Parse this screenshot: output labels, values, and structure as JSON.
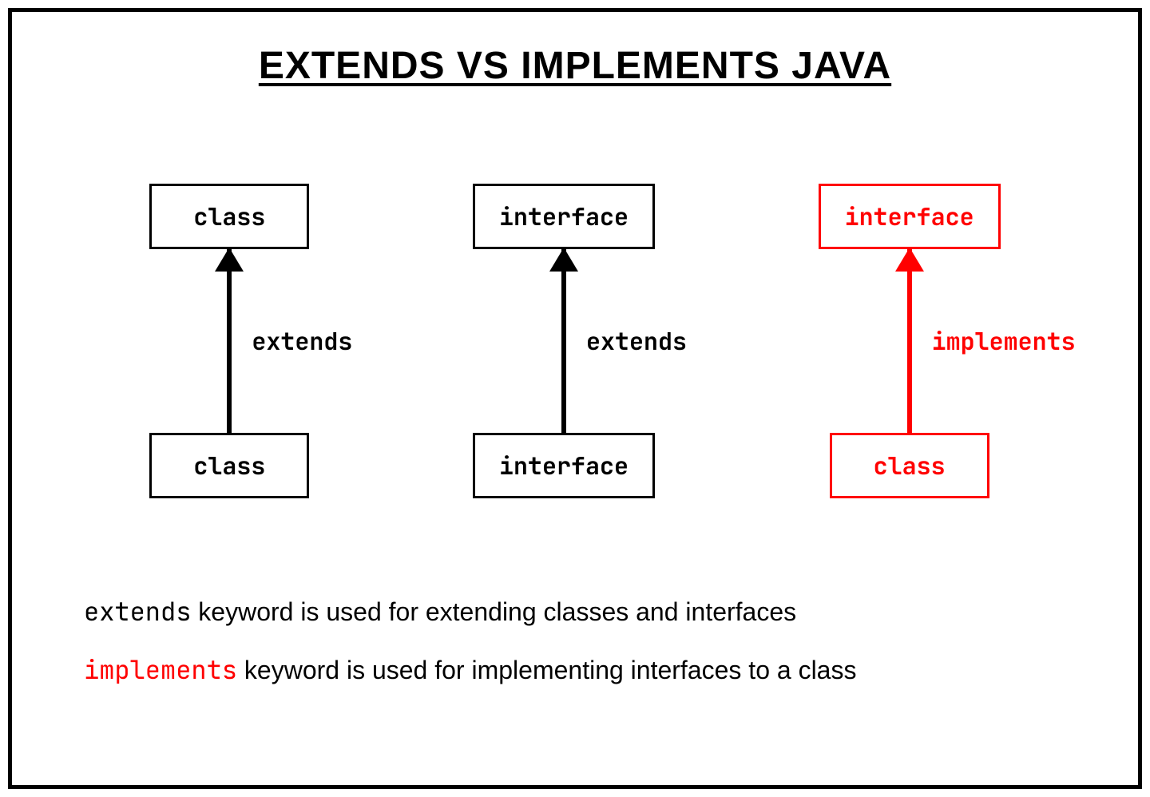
{
  "title": "EXTENDS VS IMPLEMENTS JAVA",
  "columns": [
    {
      "top": "class",
      "bottom": "class",
      "label": "extends",
      "variant": "black"
    },
    {
      "top": "interface",
      "bottom": "interface",
      "label": "extends",
      "variant": "black"
    },
    {
      "top": "interface",
      "bottom": "class",
      "label": "implements",
      "variant": "red"
    }
  ],
  "notes": {
    "line1_keyword": "extends",
    "line1_rest": " keyword is used for extending classes and interfaces",
    "line2_keyword": "implements",
    "line2_rest": " keyword is used for implementing interfaces to a class"
  }
}
